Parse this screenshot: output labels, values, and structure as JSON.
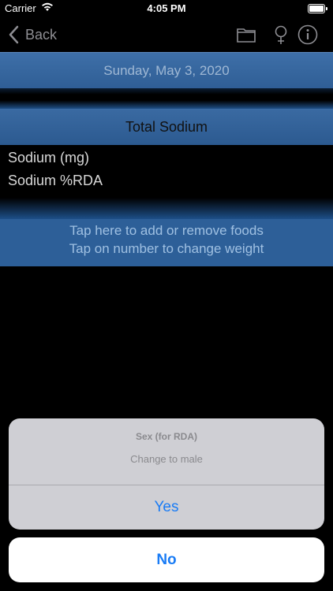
{
  "status": {
    "carrier": "Carrier",
    "time": "4:05 PM"
  },
  "nav": {
    "back_label": "Back"
  },
  "date": "Sunday, May 3, 2020",
  "section": {
    "title": "Total Sodium"
  },
  "rows": [
    {
      "label": "Sodium (mg)"
    },
    {
      "label": "Sodium %RDA"
    }
  ],
  "action": {
    "line1": "Tap here to add or remove foods",
    "line2": "Tap on number to change weight"
  },
  "sheet": {
    "title": "Sex (for RDA)",
    "message": "Change to male",
    "confirm_label": "Yes",
    "cancel_label": "No"
  },
  "colors": {
    "accent": "#1a7cf5",
    "panel_blue": "#2d5f98"
  }
}
